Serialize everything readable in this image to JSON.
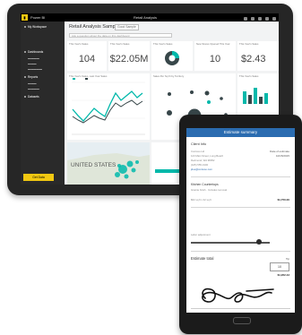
{
  "tablet": {
    "app_name": "Power BI",
    "logo_glyph": "▮",
    "top_center": "Retail Analysis",
    "dashboard_title": "Retail Analysis Sample",
    "badge_text": "Good Sample",
    "qa_placeholder": "Ask a question about the data on this dashboard",
    "nav": {
      "my_workspace": "My Workspace",
      "dashboards": "Dashboards",
      "reports": "Reports",
      "datasets": "Datasets",
      "get_data": "Get Data"
    },
    "tiles": [
      {
        "title": "This Year's Sales",
        "value": "104"
      },
      {
        "title": "This Year's Sales",
        "value": "$22.05M"
      },
      {
        "title": "This Year's Sales",
        "value": ""
      },
      {
        "title": "New Stores Opened This Year",
        "value": "10"
      },
      {
        "title": "This Year's Sales",
        "value": "$2.43"
      },
      {
        "title": "This Year's Sales, Last Year Sales",
        "value": ""
      },
      {
        "title": "Sales Per Sq Ft by Territory",
        "value": ""
      },
      {
        "title": "This Year's Sales",
        "value": ""
      }
    ],
    "map_label": "UNITED STATES",
    "colors": {
      "accent": "#f2c811",
      "teal": "#01b8aa",
      "dark": "#374649"
    }
  },
  "phone": {
    "header_title": "Estimate summary",
    "client": {
      "title": "Client Info",
      "lines": [
        "Contoso Ltd",
        "123 Main Street, Long Beach",
        "Redmond, WA 98052",
        "(425) 555-0100",
        "jdoe@contoso.com"
      ],
      "date_label": "Date of estimate",
      "date_value": "10/15/2015"
    },
    "item": {
      "title": "Kitchen Countertops",
      "subtitle": "Granite finish · Includes removal",
      "qty_text": "$62 sq ft x 32 sq ft",
      "amount": "$1,750.00"
    },
    "labor": {
      "label": "Labor adjustment",
      "level": 0.86
    },
    "total": {
      "title": "Estimate total",
      "tip_label": "Tip",
      "tip_value": "10",
      "amount": "$1,952.43"
    }
  }
}
